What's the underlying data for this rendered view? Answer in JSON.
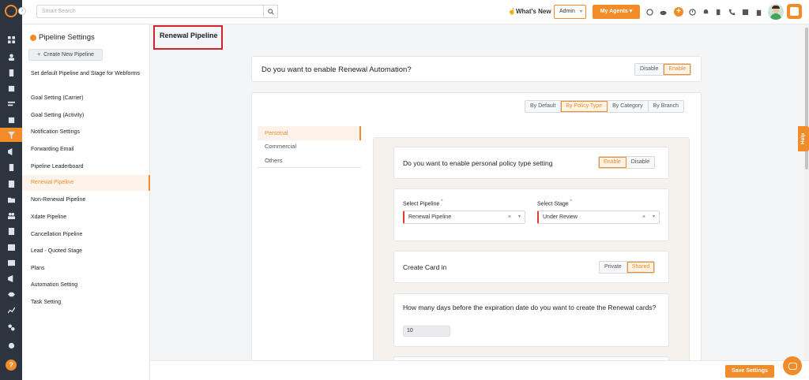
{
  "topbar": {
    "search_placeholder": "Smart Search",
    "whats_new": "What's New",
    "admin": "Admin",
    "my_agents": "My Agents"
  },
  "sidebar": {
    "title": "Pipeline Settings",
    "create_button": "Create New Pipeline",
    "items": [
      "Set default Pipeline and Stage for Webforms",
      "Goal Setting (Carrier)",
      "Goal Setting (Activity)",
      "Notification Settings",
      "Forwarding Email",
      "Pipeline Leaderboard",
      "Renewal Pipeline",
      "Non-Renewal Pipeline",
      "Xdate Pipeline",
      "Cancellation Pipeline",
      "Lead - Quoted Stage",
      "Plans",
      "Automation Setting",
      "Task Setting"
    ],
    "active_item": "Renewal Pipeline"
  },
  "page": {
    "title": "Renewal Pipeline"
  },
  "automation": {
    "question": "Do you want to enable Renewal Automation?",
    "options": [
      "Disable",
      "Enable"
    ],
    "selected": "Enable"
  },
  "filter_tabs": {
    "options": [
      "By Default",
      "By Policy Type",
      "By Category",
      "By Branch"
    ],
    "selected": "By Policy Type"
  },
  "policy_types": {
    "items": [
      "Personal",
      "Commercial",
      "Others"
    ],
    "selected": "Personal"
  },
  "personal_setting": {
    "question": "Do you want to enable personal policy type setting",
    "options": [
      "Enable",
      "Disable"
    ],
    "selected": "Enable"
  },
  "pipeline_select": {
    "pipeline_label": "Select Pipeline",
    "pipeline_value": "Renewal Pipeline",
    "stage_label": "Select Stage",
    "stage_value": "Under Review",
    "required_mark": "*",
    "clear_symbol": "×"
  },
  "create_card": {
    "label": "Create Card in",
    "options": [
      "Private",
      "Shared"
    ],
    "selected": "Shared"
  },
  "days_before": {
    "question": "How many days before the expiration date do you want to create the Renewal cards?",
    "value": "10"
  },
  "help_tab": "Help",
  "rail_help": "?",
  "save_button": "Save Settings",
  "colors": {
    "accent": "#f28c28",
    "rail": "#2c3440",
    "highlight_box": "#d6212b"
  }
}
